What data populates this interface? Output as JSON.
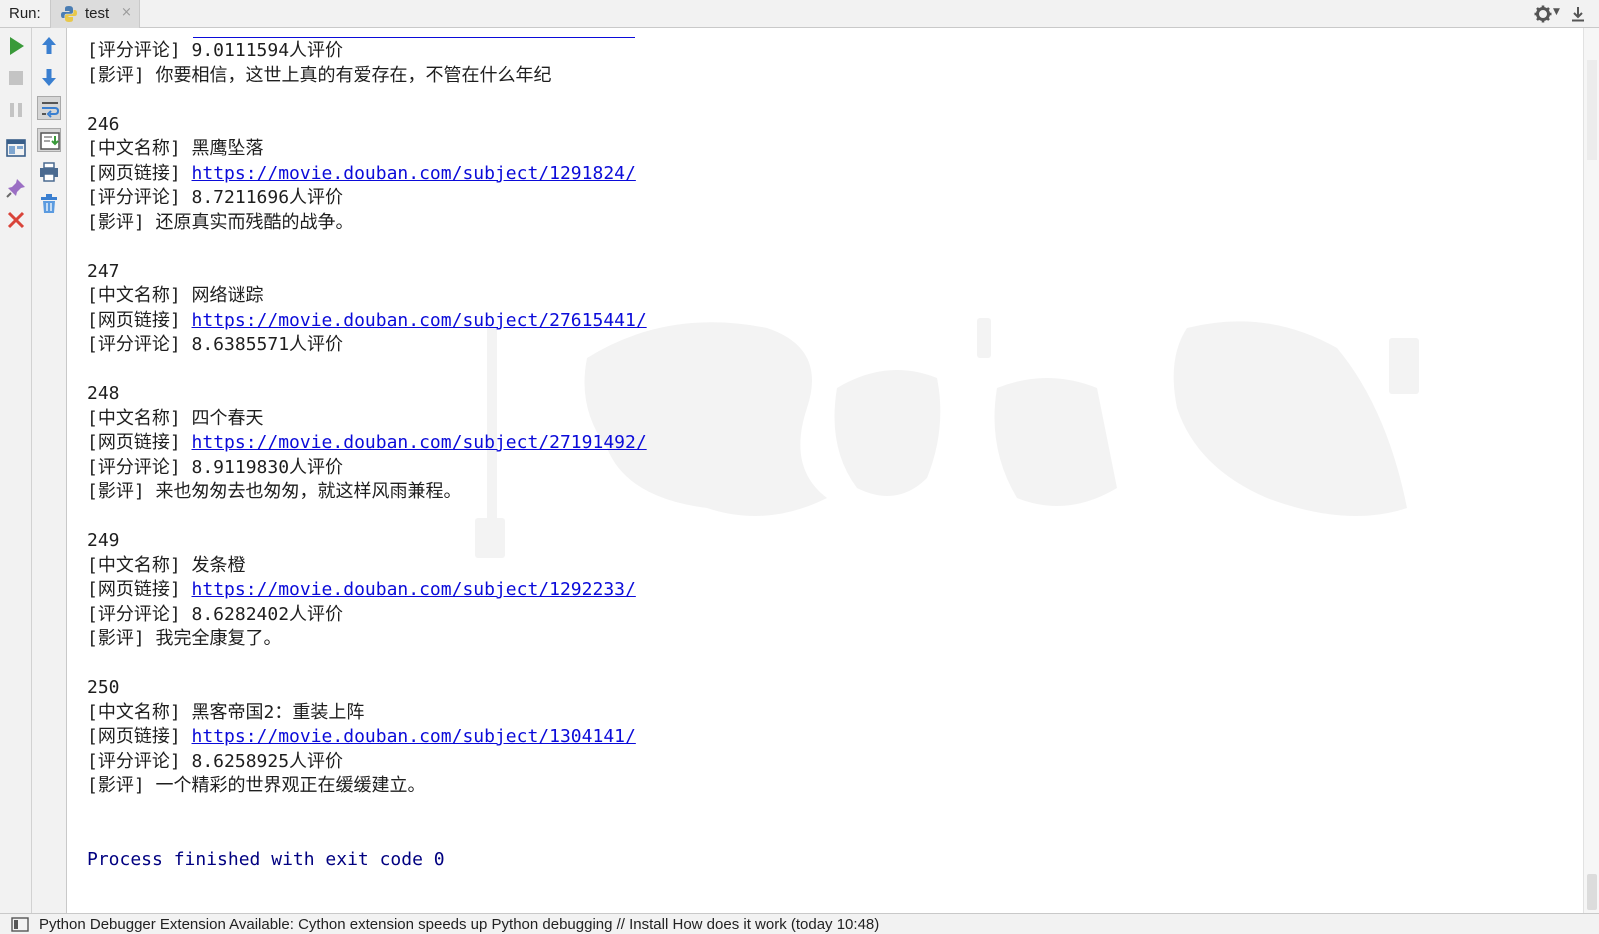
{
  "runbar": {
    "label": "Run:",
    "tab_name": "test",
    "close_glyph": "×"
  },
  "console": {
    "lines": [
      {
        "kind": "partial-link",
        "text": ""
      },
      {
        "kind": "text",
        "text": "[评分评论] 9.0111594人评价"
      },
      {
        "kind": "text",
        "text": "[影评] 你要相信，这世上真的有爱存在，不管在什么年纪"
      },
      {
        "kind": "blank",
        "text": ""
      },
      {
        "kind": "number",
        "text": "246"
      },
      {
        "kind": "text",
        "text": "[中文名称] 黑鹰坠落"
      },
      {
        "kind": "link",
        "prefix": "[网页链接] ",
        "url": "https://movie.douban.com/subject/1291824/"
      },
      {
        "kind": "text",
        "text": "[评分评论] 8.7211696人评价"
      },
      {
        "kind": "text",
        "text": "[影评] 还原真实而残酷的战争。"
      },
      {
        "kind": "blank",
        "text": ""
      },
      {
        "kind": "number",
        "text": "247"
      },
      {
        "kind": "text",
        "text": "[中文名称] 网络谜踪"
      },
      {
        "kind": "link",
        "prefix": "[网页链接] ",
        "url": "https://movie.douban.com/subject/27615441/"
      },
      {
        "kind": "text",
        "text": "[评分评论] 8.6385571人评价"
      },
      {
        "kind": "blank",
        "text": ""
      },
      {
        "kind": "number",
        "text": "248"
      },
      {
        "kind": "text",
        "text": "[中文名称] 四个春天"
      },
      {
        "kind": "link",
        "prefix": "[网页链接] ",
        "url": "https://movie.douban.com/subject/27191492/"
      },
      {
        "kind": "text",
        "text": "[评分评论] 8.9119830人评价"
      },
      {
        "kind": "text",
        "text": "[影评] 来也匆匆去也匆匆，就这样风雨兼程。"
      },
      {
        "kind": "blank",
        "text": ""
      },
      {
        "kind": "number",
        "text": "249"
      },
      {
        "kind": "text",
        "text": "[中文名称] 发条橙"
      },
      {
        "kind": "link",
        "prefix": "[网页链接] ",
        "url": "https://movie.douban.com/subject/1292233/"
      },
      {
        "kind": "text",
        "text": "[评分评论] 8.6282402人评价"
      },
      {
        "kind": "text",
        "text": "[影评] 我完全康复了。"
      },
      {
        "kind": "blank",
        "text": ""
      },
      {
        "kind": "number",
        "text": "250"
      },
      {
        "kind": "text",
        "text": "[中文名称] 黑客帝国2：重装上阵"
      },
      {
        "kind": "link",
        "prefix": "[网页链接] ",
        "url": "https://movie.douban.com/subject/1304141/"
      },
      {
        "kind": "text",
        "text": "[评分评论] 8.6258925人评价"
      },
      {
        "kind": "text",
        "text": "[影评] 一个精彩的世界观正在缓缓建立。"
      },
      {
        "kind": "blank",
        "text": ""
      },
      {
        "kind": "blank",
        "text": ""
      },
      {
        "kind": "exit",
        "text": "Process finished with exit code 0"
      }
    ],
    "watermark": "勤酬道天"
  },
  "statusbar": {
    "text": "Python Debugger Extension Available: Cython extension speeds up Python debugging // Install How does it work (today 10:48)"
  },
  "toolbar_left": [
    "run-icon",
    "stop-icon",
    "pause-icon",
    "layout-icon",
    "pin-icon",
    "close-icon"
  ],
  "toolbar_right": [
    "scroll-up-icon",
    "scroll-down-icon",
    "soft-wrap-icon",
    "scroll-to-end-icon",
    "print-icon",
    "clear-all-icon"
  ],
  "colors": {
    "link": "#0b0bd9",
    "exit": "#000080",
    "run_green": "#3a9a3a",
    "close_red": "#d9443a",
    "arrow_blue": "#3a7fd0"
  }
}
